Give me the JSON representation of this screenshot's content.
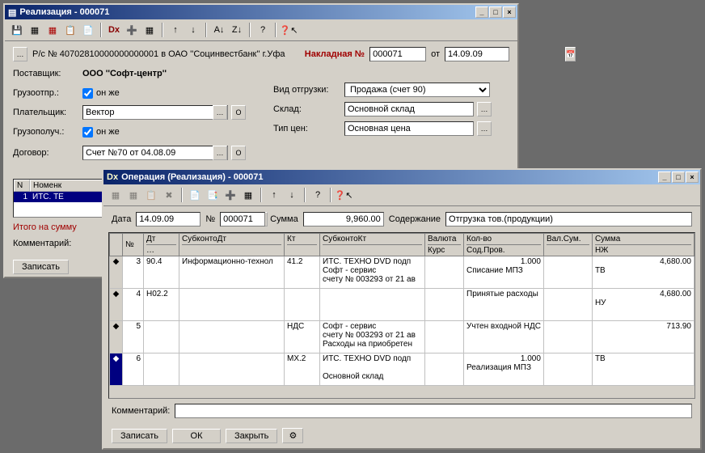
{
  "win1": {
    "title": "Реализация - 000071",
    "account_line": "Р/с № 40702810000000000001 в ОАО ''Социнвестбанк'' г.Уфа",
    "invoice_label": "Накладная №",
    "invoice_num": "000071",
    "ot": "от",
    "date": "14.09.09",
    "supplier_lbl": "Поставщик:",
    "supplier": "ООО ''Софт-центр''",
    "shipper_lbl": "Грузоотпр.:",
    "same": "он же",
    "payer_lbl": "Плательщик:",
    "payer": "Вектор",
    "consignee_lbl": "Грузополуч.:",
    "contract_lbl": "Договор:",
    "contract": "Счет №70 от 04.08.09",
    "ship_type_lbl": "Вид отгрузки:",
    "ship_type": "Продажа (счет 90)",
    "warehouse_lbl": "Склад:",
    "warehouse": "Основной склад",
    "price_type_lbl": "Тип цен:",
    "price_type": "Основная цена",
    "grid_n": "N",
    "grid_nom": "Номенк",
    "grid_row1_n": "1",
    "grid_row1_v": "ИТС. ТЕ",
    "total_lbl": "Итого на сумму",
    "comment_lbl": "Комментарий:",
    "btn_record": "Записать"
  },
  "win2": {
    "title": "Операция (Реализация) - 000071",
    "date_lbl": "Дата",
    "date": "14.09.09",
    "num_lbl": "№",
    "num": "000071",
    "sum_lbl": "Сумма",
    "sum": "9,960.00",
    "content_lbl": "Содержание",
    "content": "Отгрузка тов.(продукции)",
    "cols": {
      "n": "№",
      "dt": "Дт",
      "subdt": "СубконтоДт",
      "kt": "Кт",
      "subkt": "СубконтоКт",
      "val": "Валюта",
      "kurs": "Курс",
      "qty": "Кол-во",
      "sod": "Сод.Пров.",
      "valsum": "Вал.Сум.",
      "summ": "Сумма",
      "nzh": "НЖ"
    },
    "rows": [
      {
        "n": "3",
        "dt": "90.4",
        "subdt": "Информационно-технол",
        "kt": "41.2",
        "subkt": "ИТС. ТЕХНО DVD подп\nСофт - сервис\nсчету № 003293 от 21 ав",
        "qty": "1.000",
        "sod": "Списание МПЗ",
        "sum": "4,680.00",
        "nzh": "ТВ"
      },
      {
        "n": "4",
        "dt": "Н02.2",
        "subdt": "",
        "kt": "",
        "subkt": "",
        "qty": "",
        "sod": "Принятые расходы",
        "sum": "4,680.00",
        "nzh": "НУ"
      },
      {
        "n": "5",
        "dt": "",
        "subdt": "",
        "kt": "НДС",
        "subkt": "Софт - сервис\nсчету № 003293 от 21 ав\nРасходы на приобретен",
        "qty": "",
        "sod": "Учтен входной НДС",
        "sum": "713.90",
        "nzh": ""
      },
      {
        "n": "6",
        "dt": "",
        "subdt": "",
        "kt": "МХ.2",
        "subkt": "ИТС. ТЕХНО DVD подп\n\nОсновной склад",
        "qty": "1.000",
        "sod": "Реализация МПЗ",
        "sum": "",
        "nzh": "ТВ"
      }
    ],
    "comment_lbl": "Комментарий:",
    "btn_record": "Записать",
    "btn_ok": "ОК",
    "btn_close": "Закрыть"
  }
}
